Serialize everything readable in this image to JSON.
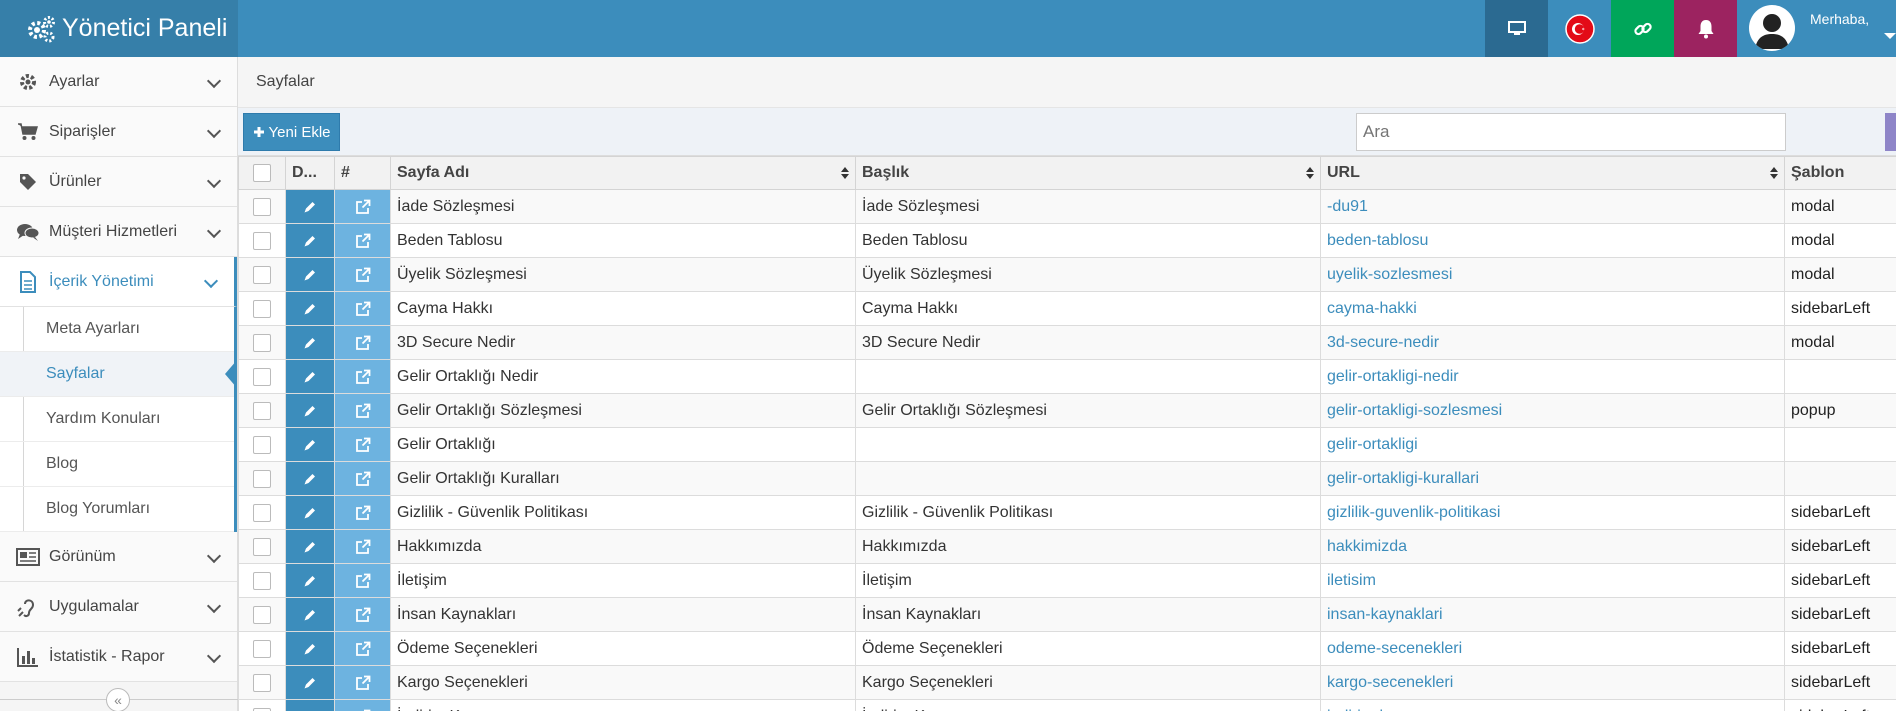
{
  "header": {
    "title": "Yönetici Paneli",
    "greeting": "Merhaba,",
    "colors": {
      "bar": "#3c8dbc",
      "monitor": "#2b6a91",
      "link": "#00a65a",
      "bell": "#9c2360"
    }
  },
  "sidebar": {
    "items": [
      {
        "label": "Ayarlar",
        "icon": "gear-icon"
      },
      {
        "label": "Siparişler",
        "icon": "cart-icon"
      },
      {
        "label": "Ürünler",
        "icon": "tag-icon"
      },
      {
        "label": "Müşteri Hizmetleri",
        "icon": "comments-icon"
      },
      {
        "label": "İçerik Yönetimi",
        "icon": "file-icon",
        "active": true
      },
      {
        "label": "Görünüm",
        "icon": "newspaper-icon"
      },
      {
        "label": "Uygulamalar",
        "icon": "hearing-icon"
      },
      {
        "label": "İstatistik - Rapor",
        "icon": "bar-chart-icon"
      }
    ],
    "subitems": [
      {
        "label": "Meta Ayarları"
      },
      {
        "label": "Sayfalar",
        "active": true
      },
      {
        "label": "Yardım Konuları"
      },
      {
        "label": "Blog"
      },
      {
        "label": "Blog Yorumları"
      }
    ]
  },
  "breadcrumb": "Sayfalar",
  "toolbar": {
    "add_label": "Yeni Ekle",
    "search_placeholder": "Ara"
  },
  "table": {
    "headers": [
      "D...",
      "#",
      "Sayfa Adı",
      "Başlık",
      "URL",
      "Şablon"
    ],
    "rows": [
      {
        "name": "İade Sözleşmesi",
        "title": "İade Sözleşmesi",
        "url": "-du91",
        "template": "modal"
      },
      {
        "name": "Beden Tablosu",
        "title": "Beden Tablosu",
        "url": "beden-tablosu",
        "template": "modal"
      },
      {
        "name": "Üyelik Sözleşmesi",
        "title": "Üyelik Sözleşmesi",
        "url": "uyelik-sozlesmesi",
        "template": "modal"
      },
      {
        "name": "Cayma Hakkı",
        "title": "Cayma Hakkı",
        "url": "cayma-hakki",
        "template": "sidebarLeft"
      },
      {
        "name": "3D Secure Nedir",
        "title": "3D Secure Nedir",
        "url": "3d-secure-nedir",
        "template": "modal"
      },
      {
        "name": "Gelir Ortaklığı Nedir",
        "title": "",
        "url": "gelir-ortakligi-nedir",
        "template": ""
      },
      {
        "name": "Gelir Ortaklığı Sözleşmesi",
        "title": "Gelir Ortaklığı Sözleşmesi",
        "url": "gelir-ortakligi-sozlesmesi",
        "template": "popup"
      },
      {
        "name": "Gelir Ortaklığı",
        "title": "",
        "url": "gelir-ortakligi",
        "template": ""
      },
      {
        "name": "Gelir Ortaklığı Kuralları",
        "title": "",
        "url": "gelir-ortakligi-kurallari",
        "template": ""
      },
      {
        "name": "Gizlilik - Güvenlik Politikası",
        "title": "Gizlilik - Güvenlik Politikası",
        "url": "gizlilik-guvenlik-politikasi",
        "template": "sidebarLeft"
      },
      {
        "name": "Hakkımızda",
        "title": "Hakkımızda",
        "url": "hakkimizda",
        "template": "sidebarLeft"
      },
      {
        "name": "İletişim",
        "title": "İletişim",
        "url": "iletisim",
        "template": "sidebarLeft"
      },
      {
        "name": "İnsan Kaynakları",
        "title": "İnsan Kaynakları",
        "url": "insan-kaynaklari",
        "template": "sidebarLeft"
      },
      {
        "name": "Ödeme Seçenekleri",
        "title": "Ödeme Seçenekleri",
        "url": "odeme-secenekleri",
        "template": "sidebarLeft"
      },
      {
        "name": "Kargo Seçenekleri",
        "title": "Kargo Seçenekleri",
        "url": "kargo-secenekleri",
        "template": "sidebarLeft"
      },
      {
        "name": "İndirim Kuponu",
        "title": "İndirim Kuponu",
        "url": "indirim-kuponu",
        "template": "sidebarLeft"
      }
    ]
  }
}
